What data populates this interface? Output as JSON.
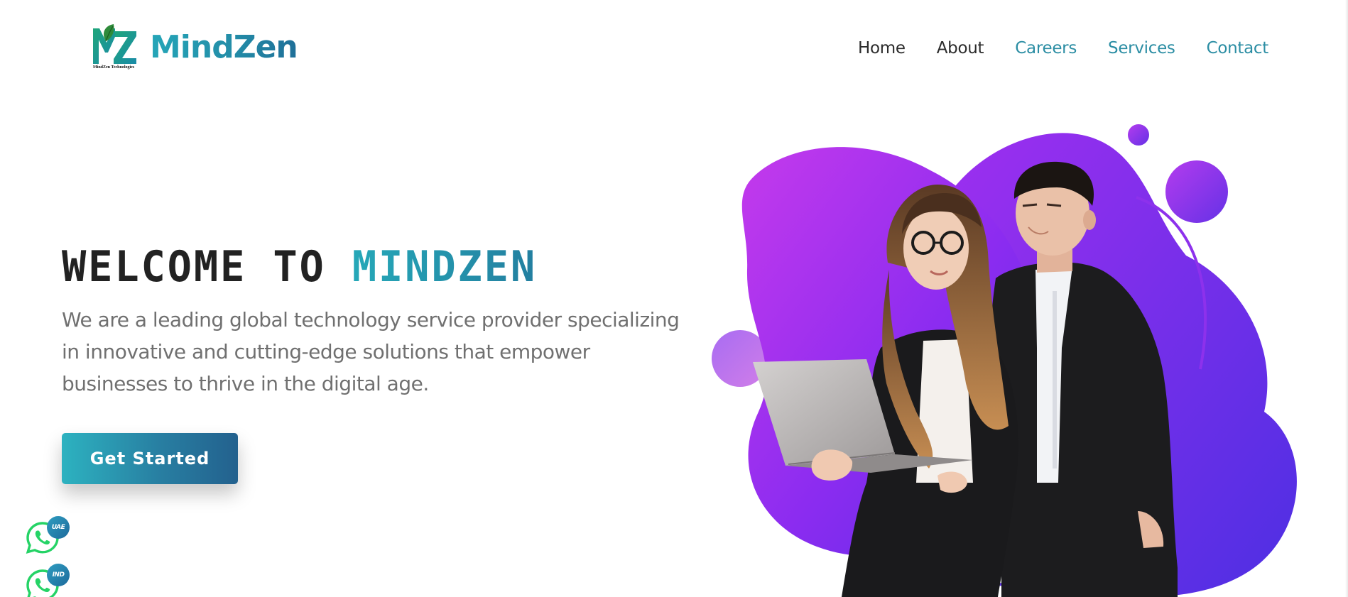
{
  "brand": {
    "name": "MindZen",
    "caption": "MindZen Technologies",
    "logo_icon": "mindzen-leaf-mz-logo"
  },
  "nav": {
    "items": [
      {
        "label": "Home"
      },
      {
        "label": "About"
      },
      {
        "label": "Careers"
      },
      {
        "label": "Services"
      },
      {
        "label": "Contact"
      }
    ]
  },
  "hero": {
    "title_prefix": "WELCOME TO",
    "title_accent": "MINDZEN",
    "description_lines": [
      "We are a leading global technology service provider specializing",
      "in innovative and cutting-edge solutions that empower",
      "businesses to thrive in the digital age."
    ],
    "cta_label": "Get Started"
  },
  "whatsapp": [
    {
      "icon": "whatsapp-icon",
      "badge": "UAE"
    },
    {
      "icon": "whatsapp-icon",
      "badge": "IND"
    }
  ],
  "illustration": {
    "description_icon": "business-people-with-laptop-illustration"
  },
  "colors": {
    "accent_teal": "#2c8ea4",
    "accent_dark_teal": "#23618e",
    "blob_purple": "#b330e8",
    "blob_indigo": "#5d2be6",
    "whatsapp_green": "#25d366",
    "text_dark": "#222222",
    "text_gray": "#707070"
  }
}
